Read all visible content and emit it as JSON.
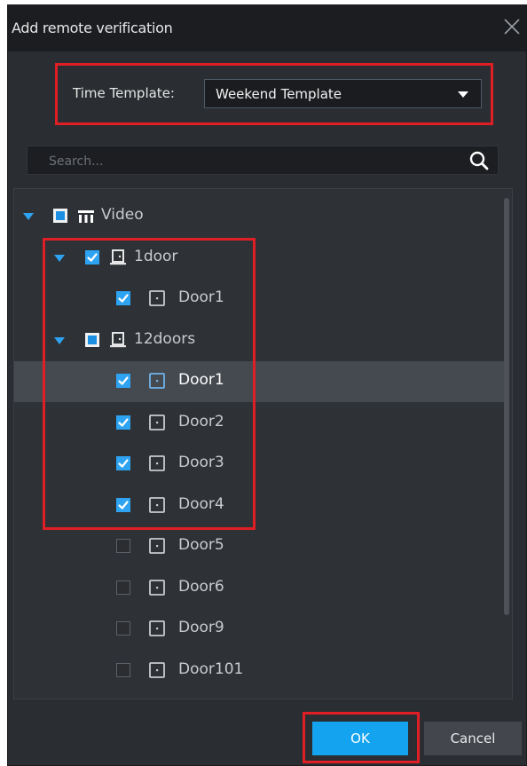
{
  "dialog": {
    "title": "Add remote verification"
  },
  "time_template": {
    "label": "Time Template:",
    "value": "Weekend Template"
  },
  "search": {
    "placeholder": "Search..."
  },
  "tree": [
    {
      "label": "Video",
      "level": 0,
      "check": "partial",
      "expanded": true,
      "icon": "video-group-icon",
      "selected": false
    },
    {
      "label": "1door",
      "level": 1,
      "check": "checked",
      "expanded": true,
      "icon": "door-controller-icon",
      "selected": false
    },
    {
      "label": "Door1",
      "level": 2,
      "check": "checked",
      "icon": "door-icon",
      "selected": false
    },
    {
      "label": "12doors",
      "level": 1,
      "check": "partial",
      "expanded": true,
      "icon": "door-controller-icon",
      "selected": false
    },
    {
      "label": "Door1",
      "level": 2,
      "check": "checked",
      "icon": "door-icon",
      "selected": true
    },
    {
      "label": "Door2",
      "level": 2,
      "check": "checked",
      "icon": "door-icon",
      "selected": false
    },
    {
      "label": "Door3",
      "level": 2,
      "check": "checked",
      "icon": "door-icon",
      "selected": false
    },
    {
      "label": "Door4",
      "level": 2,
      "check": "checked",
      "icon": "door-icon",
      "selected": false
    },
    {
      "label": "Door5",
      "level": 2,
      "check": "unchecked",
      "icon": "door-icon",
      "selected": false
    },
    {
      "label": "Door6",
      "level": 2,
      "check": "unchecked",
      "icon": "door-icon",
      "selected": false
    },
    {
      "label": "Door9",
      "level": 2,
      "check": "unchecked",
      "icon": "door-icon",
      "selected": false
    },
    {
      "label": "Door101",
      "level": 2,
      "check": "unchecked",
      "icon": "door-icon",
      "selected": false
    }
  ],
  "buttons": {
    "ok": "OK",
    "cancel": "Cancel"
  },
  "colors": {
    "accent": "#14a3ee",
    "highlight_box": "#e01e25",
    "background": "#2a2d31"
  }
}
